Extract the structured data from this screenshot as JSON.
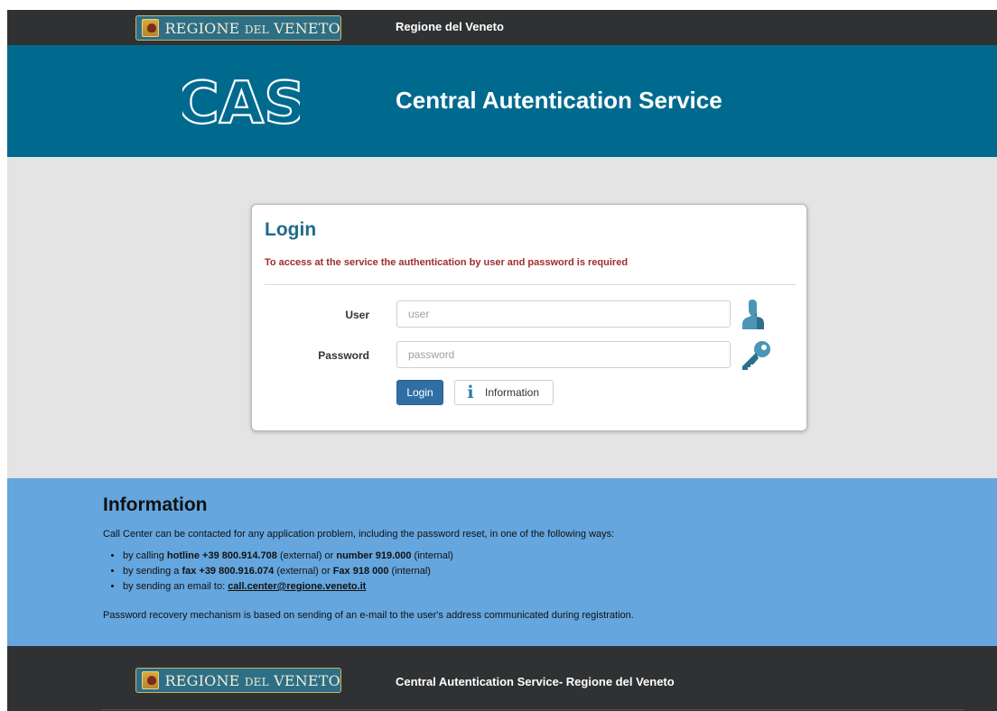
{
  "top_bar": {
    "logo_text_1": "REGIONE",
    "logo_text_2": "DEL",
    "logo_text_3": "VENETO",
    "title": "Regione del Veneto"
  },
  "hero": {
    "logo_text": "CAS",
    "title": "Central Autentication Service"
  },
  "login_card": {
    "title": "Login",
    "subtitle": "To access at the service the authentication by user and password is required",
    "user_label": "User",
    "user_placeholder": "user",
    "password_label": "Password",
    "password_placeholder": "password",
    "login_button": "Login",
    "info_button": "Information"
  },
  "information": {
    "title": "Information",
    "intro": "Call Center can be contacted for any application problem, including the password reset, in one of the following ways:",
    "item1": {
      "a": "by calling ",
      "b": "hotline +39 800.914.708",
      "c": " (external) or ",
      "d": "number 919.000",
      "e": " (internal)"
    },
    "item2": {
      "a": "by sending a ",
      "b": "fax +39 800.916.074",
      "c": " (external) or ",
      "d": "Fax 918 000",
      "e": " (internal)"
    },
    "item3": {
      "a": "by sending an email to: ",
      "email": "call.center@regione.veneto.it"
    },
    "note": "Password recovery mechanism is based on sending of an e-mail to the user's address communicated during registration."
  },
  "footer": {
    "logo_text_1": "REGIONE",
    "logo_text_2": "DEL",
    "logo_text_3": "VENETO",
    "title": "Central Autentication Service- Regione del Veneto"
  },
  "colors": {
    "dark_bar": "#2f3133",
    "hero_blue": "#006a8e",
    "content_gray": "#e4e4e4",
    "info_blue": "#65a6de",
    "accent_title": "#1f6b8b",
    "warning_text": "#9e2c2c",
    "button_blue": "#2f6fa6"
  },
  "icons": {
    "crest": "regione-veneto-crest-icon",
    "user": "user-silhouette-icon",
    "password": "key-icon",
    "info": "info-icon"
  }
}
